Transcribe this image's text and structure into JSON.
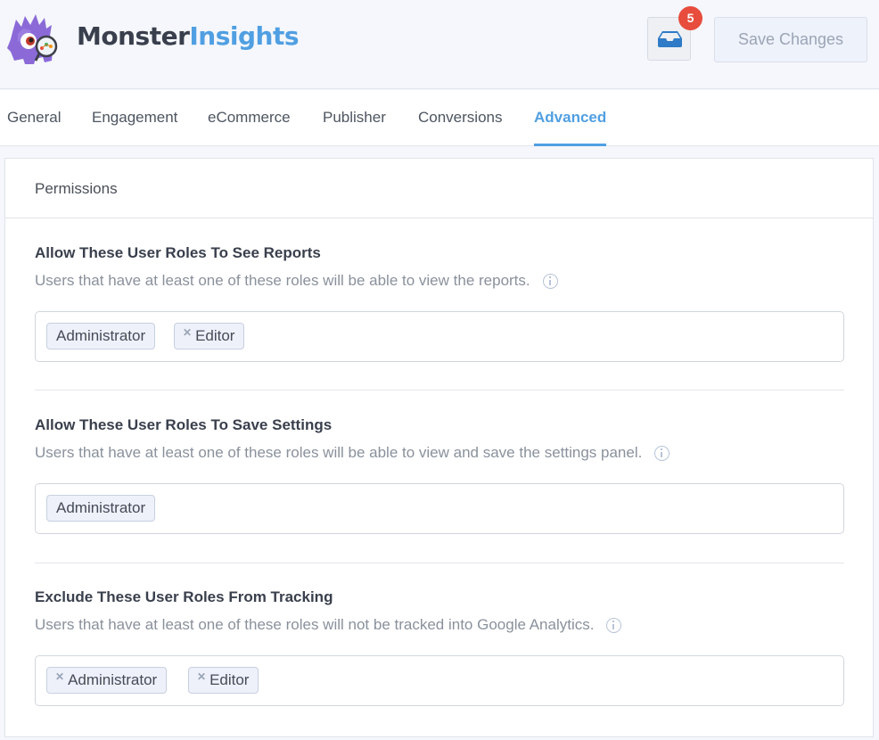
{
  "header": {
    "brand_part1": "Monster",
    "brand_part2": "Insights",
    "logo_icon": "monster-mascot-logo",
    "inbox_icon": "inbox-tray-icon",
    "notification_count": "5",
    "save_label": "Save Changes"
  },
  "tabs": [
    {
      "label": "General",
      "active": false
    },
    {
      "label": "Engagement",
      "active": false
    },
    {
      "label": "eCommerce",
      "active": false
    },
    {
      "label": "Publisher",
      "active": false
    },
    {
      "label": "Conversions",
      "active": false
    },
    {
      "label": "Advanced",
      "active": true
    }
  ],
  "panel": {
    "title": "Permissions",
    "sections": [
      {
        "title": "Allow These User Roles To See Reports",
        "description": "Users that have at least one of these roles will be able to view the reports.",
        "chips": [
          {
            "label": "Administrator",
            "removable": false
          },
          {
            "label": "Editor",
            "removable": true
          }
        ]
      },
      {
        "title": "Allow These User Roles To Save Settings",
        "description": "Users that have at least one of these roles will be able to view and save the settings panel.",
        "chips": [
          {
            "label": "Administrator",
            "removable": false
          }
        ]
      },
      {
        "title": "Exclude These User Roles From Tracking",
        "description": "Users that have at least one of these roles will not be tracked into Google Analytics.",
        "chips": [
          {
            "label": "Administrator",
            "removable": true
          },
          {
            "label": "Editor",
            "removable": true
          }
        ]
      }
    ]
  },
  "colors": {
    "accent": "#509fe2",
    "badge": "#e74c3c",
    "brand_dark": "#393f4c",
    "logo_purple": "#8b6ad8"
  }
}
